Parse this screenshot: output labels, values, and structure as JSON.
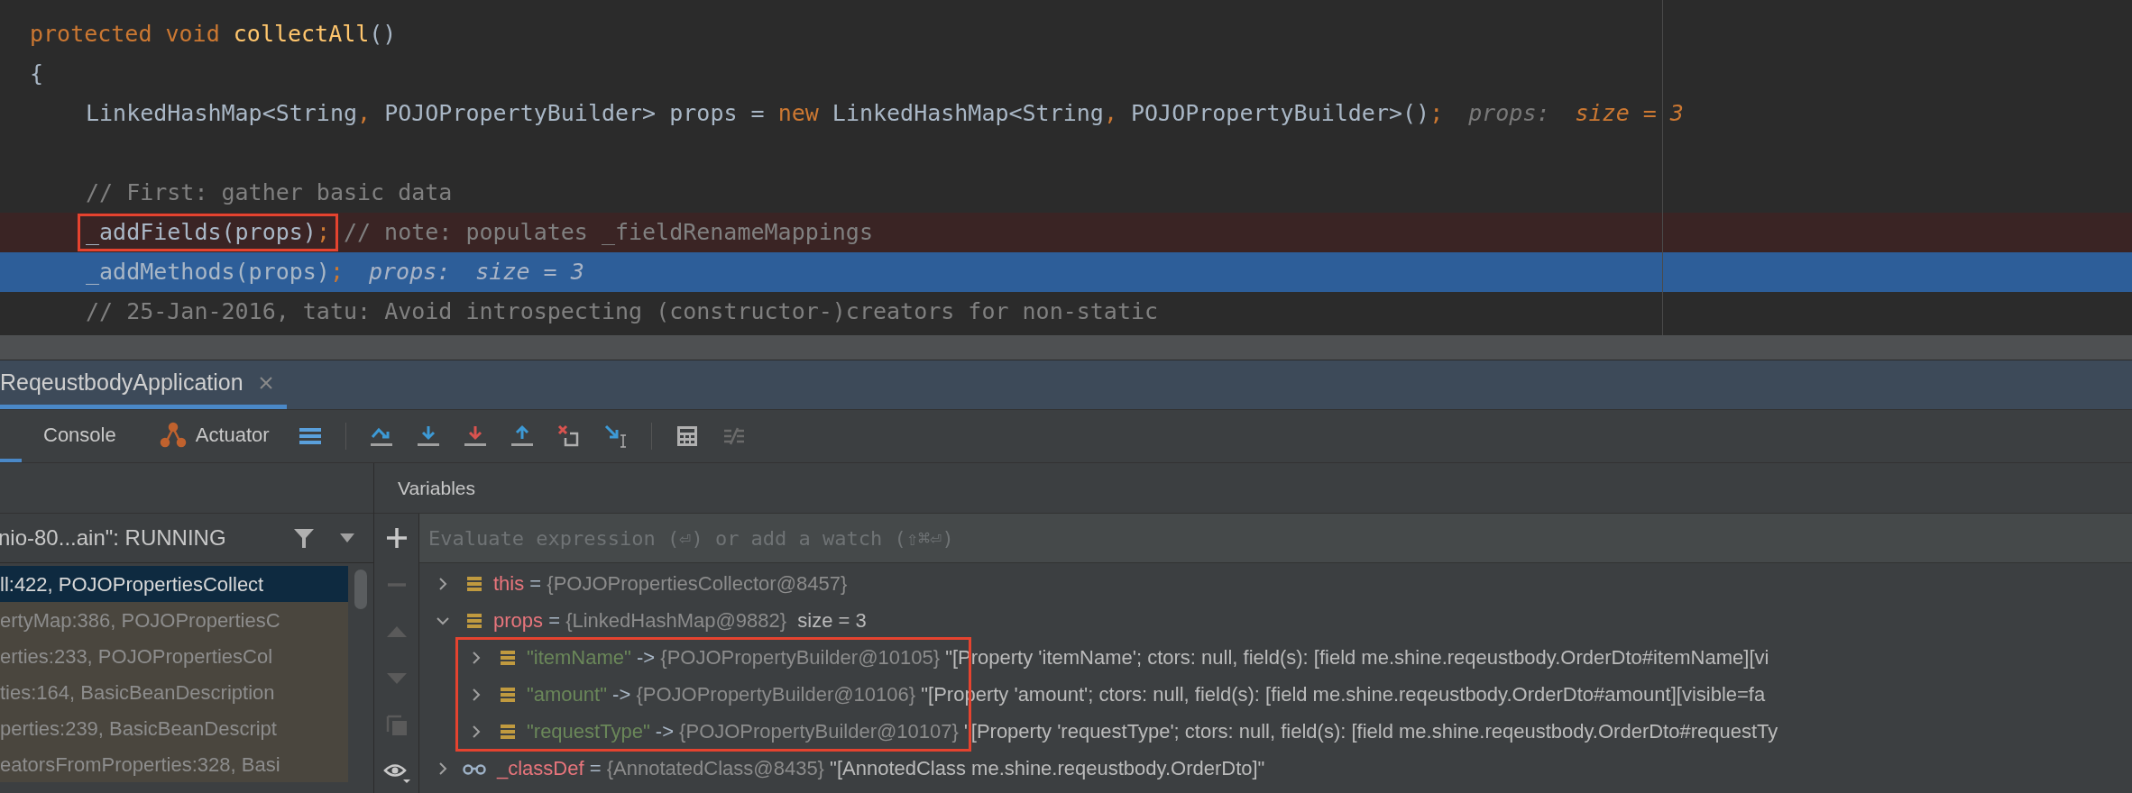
{
  "code": {
    "header_lines": [
      {
        "segments": [
          {
            "kind": "keyword",
            "text": "protected void "
          },
          {
            "kind": "method",
            "text": "collectAll"
          },
          {
            "kind": "plain",
            "text": "()"
          }
        ]
      },
      {
        "segments": [
          {
            "kind": "plain",
            "text": "{"
          }
        ]
      }
    ],
    "body_blocks": [
      {
        "lines": [
          {
            "segments": [
              {
                "kind": "plain",
                "text": "LinkedHashMap<String"
              },
              {
                "kind": "keyword",
                "text": ","
              },
              {
                "kind": "plain",
                "text": " POJOPropertyBuilder> props = "
              },
              {
                "kind": "keyword",
                "text": "new"
              },
              {
                "kind": "plain",
                "text": " LinkedHashMap<String"
              },
              {
                "kind": "keyword",
                "text": ","
              },
              {
                "kind": "plain",
                "text": " POJOPropertyBuilder>()"
              },
              {
                "kind": "keyword",
                "text": ";"
              }
            ],
            "hint": {
              "name": "props:",
              "value": "size = 3",
              "changed": true
            }
          }
        ]
      },
      {
        "lines": [
          {
            "segments": [
              {
                "kind": "comment",
                "text": "// First: gather basic data"
              }
            ]
          },
          {
            "kind": "breakpoint",
            "boxed": [
              {
                "kind": "plain",
                "text": "_addFields(props)"
              },
              {
                "kind": "keyword",
                "text": ";"
              }
            ],
            "segments": [
              {
                "kind": "comment",
                "text": "// note: populates _fieldRenameMappings"
              }
            ]
          },
          {
            "kind": "current",
            "segments": [
              {
                "kind": "plain",
                "text": "_addMethods(props)"
              },
              {
                "kind": "keyword",
                "text": ";"
              }
            ],
            "hint": {
              "name": "props:",
              "value": "size = 3",
              "changed": false
            }
          },
          {
            "segments": [
              {
                "kind": "comment",
                "text": "// 25-Jan-2016, tatu: Avoid introspecting (constructor-)creators for non-static"
              }
            ]
          }
        ]
      }
    ]
  },
  "run_tabs": [
    {
      "label": "ReqeustbodyApplication",
      "selected": true
    }
  ],
  "toolbar_tabs": [
    {
      "label": "Console",
      "selected": false
    },
    {
      "label": "Actuator",
      "selected": false
    }
  ],
  "thread": {
    "label": "nio-80...ain\": RUNNING"
  },
  "frames": [
    {
      "text": "ll:422, POJOPropertiesCollect",
      "selected": true,
      "library": false
    },
    {
      "text": "ertyMap:386, POJOPropertiesC",
      "selected": false,
      "library": true
    },
    {
      "text": "erties:233, POJOPropertiesCol",
      "selected": false,
      "library": true
    },
    {
      "text": "ties:164, BasicBeanDescription",
      "selected": false,
      "library": true
    },
    {
      "text": "perties:239, BasicBeanDescript",
      "selected": false,
      "library": true
    },
    {
      "text": "eatorsFromProperties:328, Basi",
      "selected": false,
      "library": true
    }
  ],
  "variables": {
    "title": "Variables",
    "placeholder": "Evaluate expression (⏎) or add a watch (⇧⌘⏎)",
    "items": [
      {
        "kind": "field",
        "name": "this",
        "separator": "=",
        "value": "{POJOPropertiesCollector@8457}",
        "expanded": false
      },
      {
        "kind": "field",
        "name": "props",
        "separator": "=",
        "value": "{LinkedHashMap@9882}",
        "size": "size = 3",
        "expanded": true,
        "boxed_children": true,
        "children": [
          {
            "kind": "entry",
            "key": "\"itemName\"",
            "separator": "->",
            "value": "{POJOPropertyBuilder@10105}",
            "description": "\"[Property 'itemName'; ctors: null, field(s): [field me.shine.reqeustbody.OrderDto#itemName][vi",
            "expanded": false
          },
          {
            "kind": "entry",
            "key": "\"amount\"",
            "separator": "->",
            "value": "{POJOPropertyBuilder@10106}",
            "description": "\"[Property 'amount'; ctors: null, field(s): [field me.shine.reqeustbody.OrderDto#amount][visible=fa",
            "expanded": false
          },
          {
            "kind": "entry",
            "key": "\"requestType\"",
            "separator": "->",
            "value": "{POJOPropertyBuilder@10107}",
            "description": "\"[Property 'requestType'; ctors: null, field(s): [field me.shine.reqeustbody.OrderDto#requestTy",
            "expanded": false
          }
        ]
      },
      {
        "kind": "viewer",
        "name": "_classDef",
        "separator": "=",
        "value": "{AnnotatedClass@8435}",
        "description": "\"[AnnotedClass me.shine.reqeustbody.OrderDto]\"",
        "expanded": false
      }
    ]
  }
}
